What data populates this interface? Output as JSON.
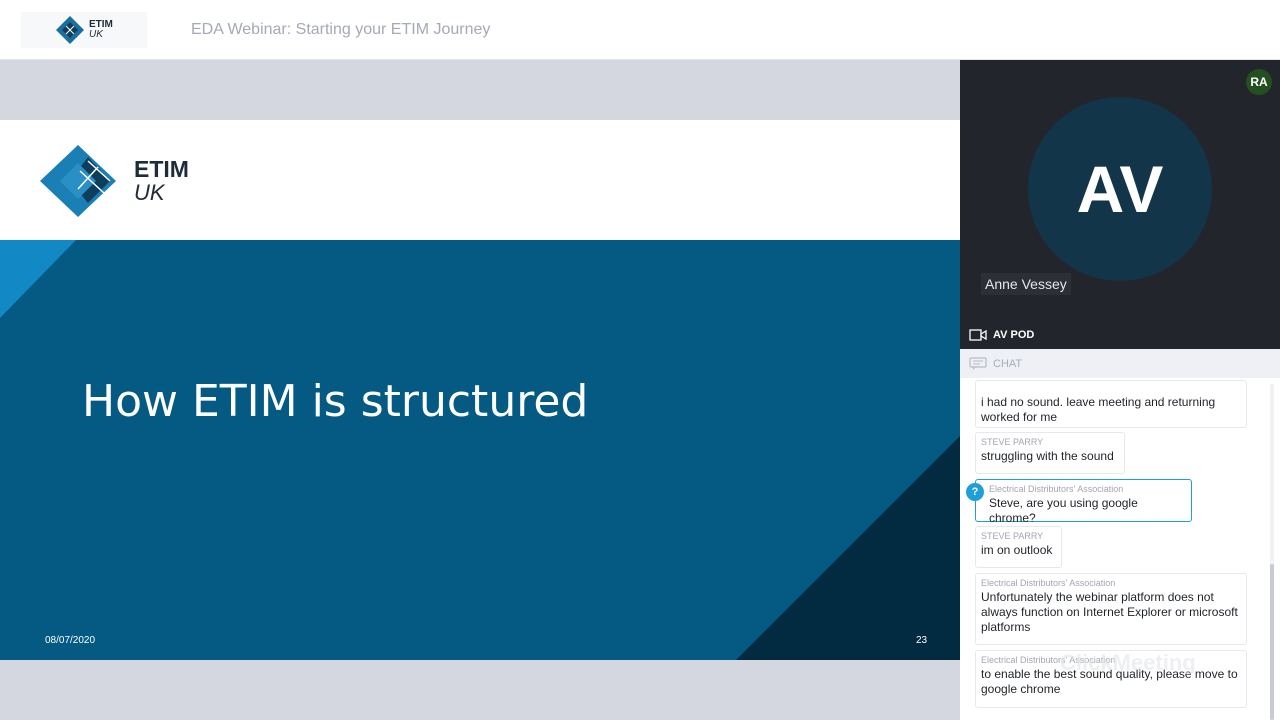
{
  "header": {
    "logo": {
      "line1": "ETIM",
      "line2": "UK"
    },
    "title": "EDA Webinar: Starting your ETIM Journey"
  },
  "slide": {
    "logo": {
      "line1": "ETIM",
      "line2": "UK"
    },
    "heading": "How ETIM is structured",
    "date": "08/07/2020",
    "page_number": "23",
    "colors": {
      "body": "#045a82",
      "accent": "#1288c4",
      "dark": "#022b41"
    }
  },
  "video": {
    "avatar_initials": "AV",
    "participant_name": "Anne Vessey",
    "self_badge": "RA"
  },
  "pods": {
    "av_pod_label": "AV POD",
    "chat_label": "CHAT"
  },
  "chat": {
    "messages": [
      {
        "author": "",
        "text": "i had no sound. leave meeting and returning worked for me"
      },
      {
        "author": "STEVE PARRY",
        "text": "struggling with the sound"
      },
      {
        "author": "Electrical Distributors' Association",
        "text": "Steve, are you using google chrome?",
        "question": true
      },
      {
        "author": "STEVE PARRY",
        "text": "im on outlook"
      },
      {
        "author": "Electrical Distributors' Association",
        "text": "Unfortunately the webinar platform does not always function on Internet Explorer or microsoft platforms"
      },
      {
        "author": "Electrical Distributors' Association",
        "text": "to enable the best sound quality, please move to google chrome"
      }
    ],
    "question_icon": "?",
    "watermark": "ClickMeeting"
  }
}
